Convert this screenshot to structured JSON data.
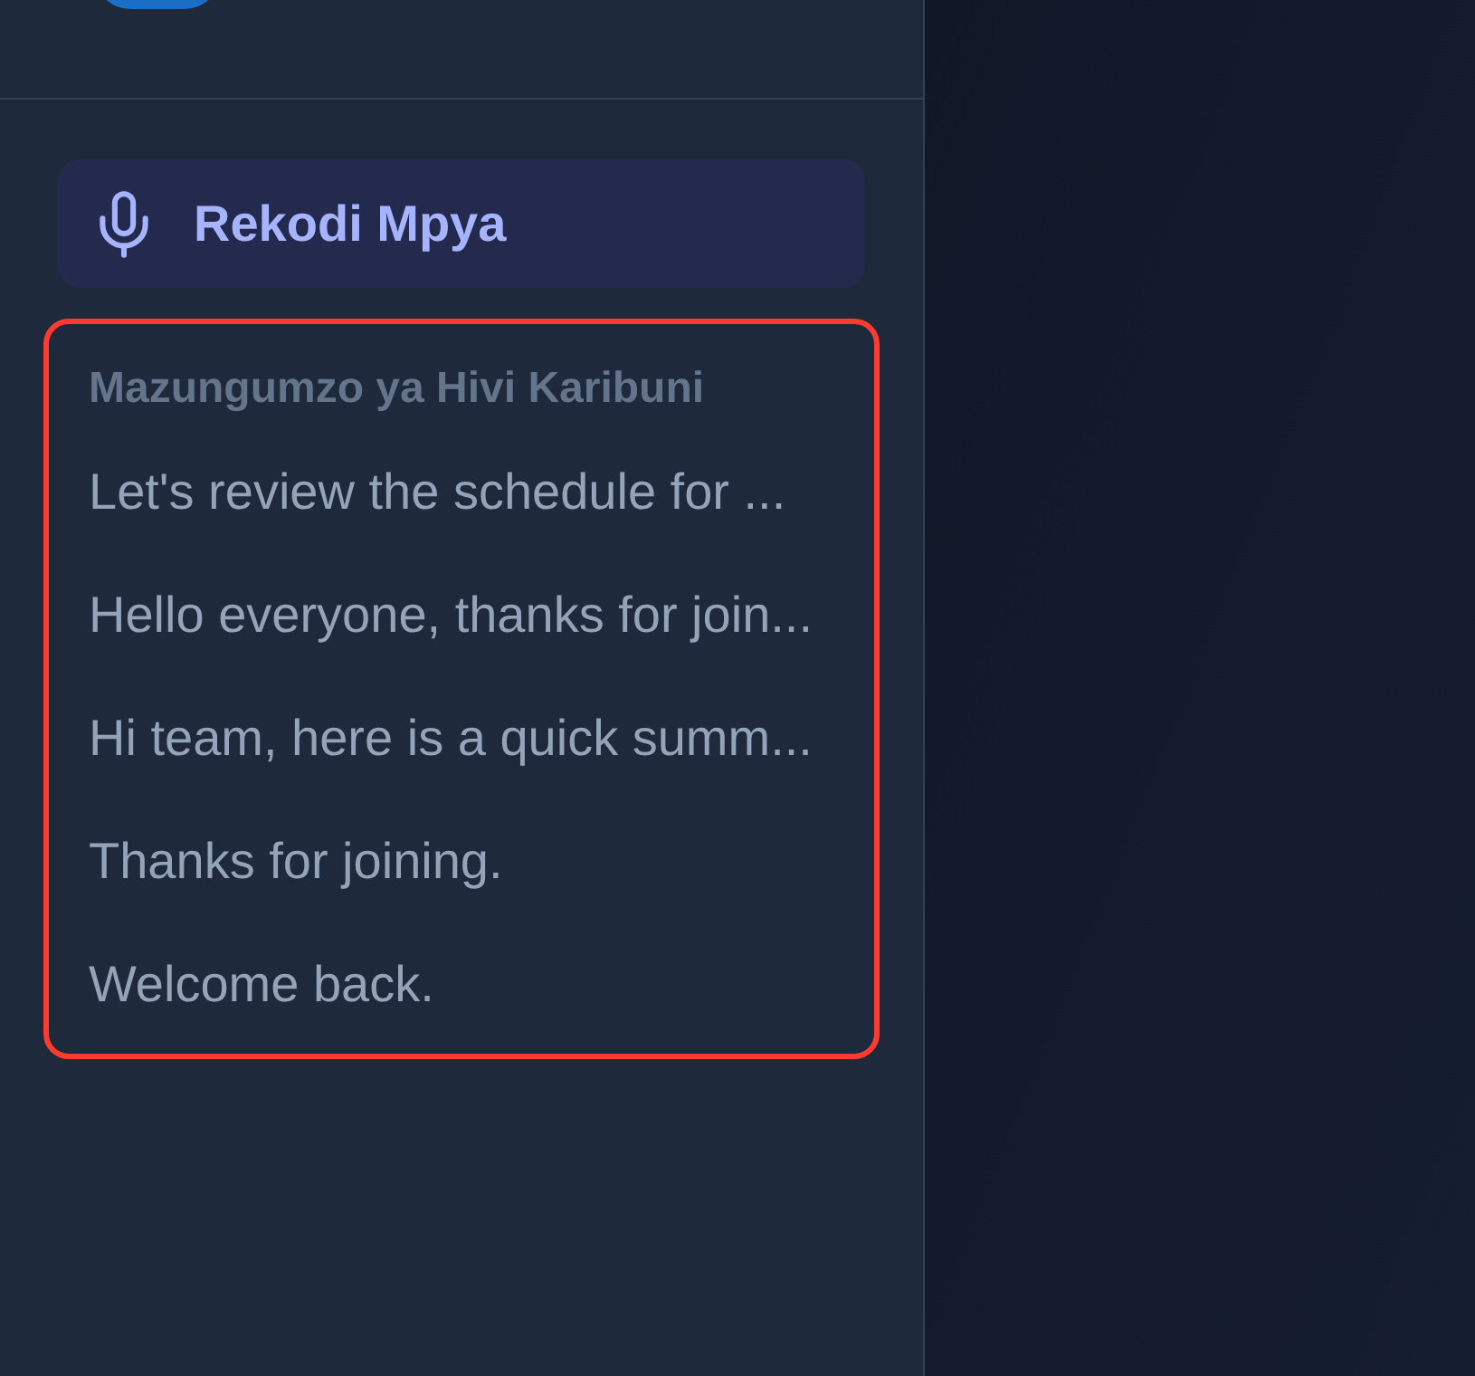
{
  "sidebar": {
    "new_recording_button": {
      "label": "Rekodi Mpya"
    },
    "recent": {
      "highlighted": true,
      "heading": "Mazungumzo ya Hivi Karibuni",
      "items": [
        {
          "title": "Let's review the schedule for ...",
          "selected": false
        },
        {
          "title": "Hello everyone, thanks for join...",
          "selected": false
        },
        {
          "title": "Hi team, here is a quick summ...",
          "selected": false
        },
        {
          "title": "Thanks for joining.",
          "selected": false
        },
        {
          "title": "Welcome back.",
          "selected": false
        }
      ]
    }
  }
}
